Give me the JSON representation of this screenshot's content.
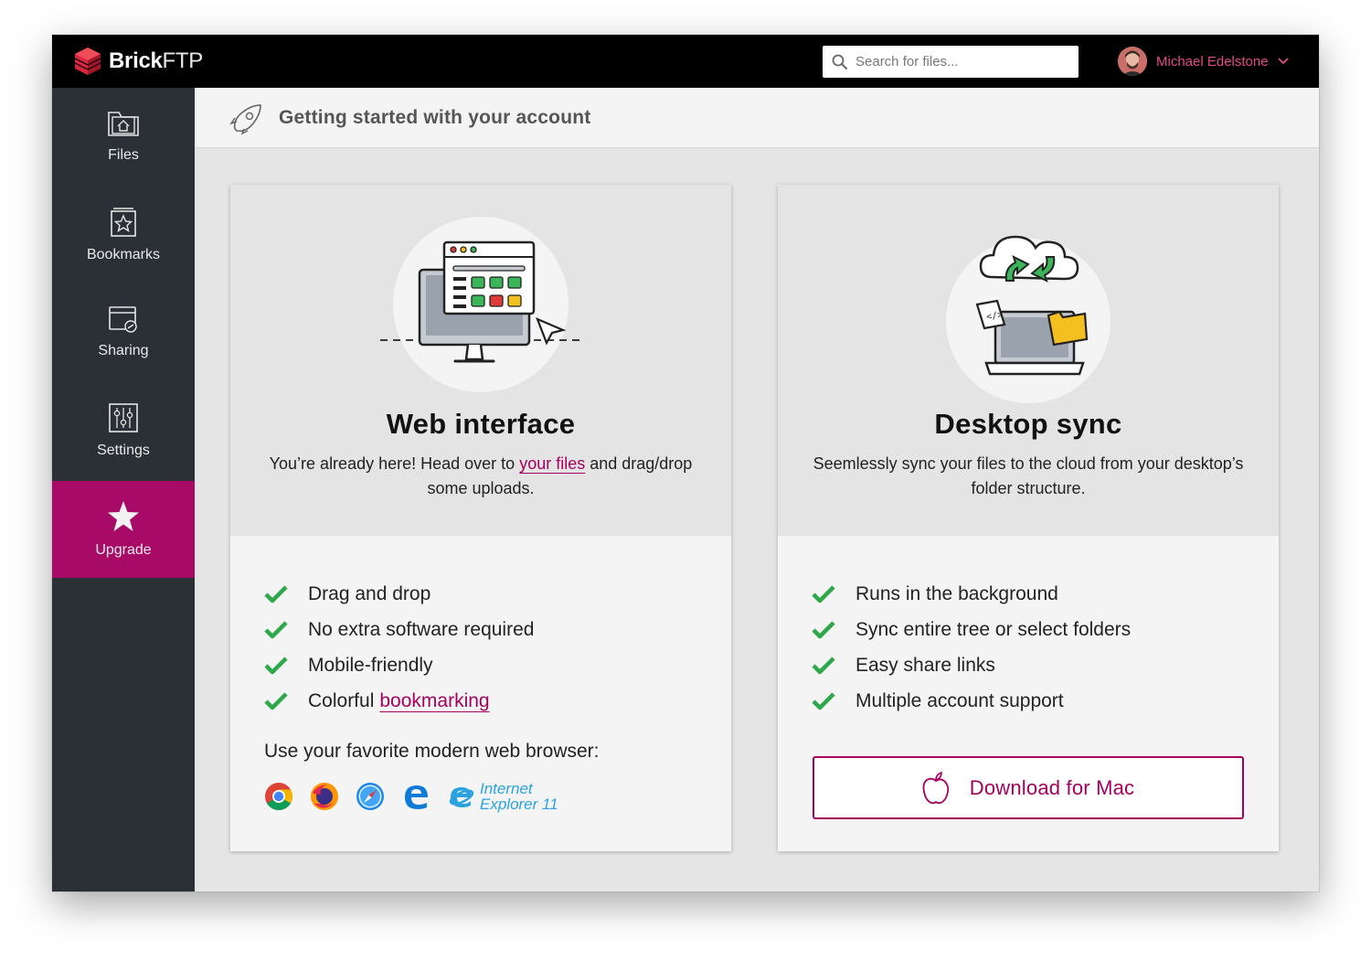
{
  "brand": {
    "name_bold": "Brick",
    "name_light": "FTP"
  },
  "search": {
    "placeholder": "Search for files..."
  },
  "user": {
    "name": "Michael Edelstone"
  },
  "sidebar": {
    "items": [
      {
        "label": "Files",
        "icon": "folder-home-icon"
      },
      {
        "label": "Bookmarks",
        "icon": "bookmark-star-icon"
      },
      {
        "label": "Sharing",
        "icon": "sharing-link-icon"
      },
      {
        "label": "Settings",
        "icon": "sliders-icon"
      },
      {
        "label": "Upgrade",
        "icon": "star-icon",
        "active": true
      }
    ]
  },
  "main": {
    "title": "Getting started with your account"
  },
  "web_card": {
    "title": "Web interface",
    "desc_before": "You’re already here! Head over to ",
    "desc_link": "your files",
    "desc_after": " and drag/drop some uploads.",
    "features": [
      "Drag and drop",
      "No extra software required",
      "Mobile-friendly"
    ],
    "feature_last_prefix": "Colorful",
    "feature_last_link": "bookmarking",
    "browsers_label": "Use your favorite modern web browser:",
    "ie_line1": "Internet",
    "ie_line2": "Explorer 11"
  },
  "desktop_card": {
    "title": "Desktop sync",
    "desc": "Seemlessly sync your files to the cloud from your desktop’s folder structure.",
    "features": [
      "Runs in the background",
      "Sync entire tree or select folders",
      "Easy share links",
      "Multiple account support"
    ],
    "download_label": "Download for Mac"
  },
  "colors": {
    "accent": "#a4005e",
    "sidebar": "#2b3036",
    "check": "#2ea84a"
  }
}
